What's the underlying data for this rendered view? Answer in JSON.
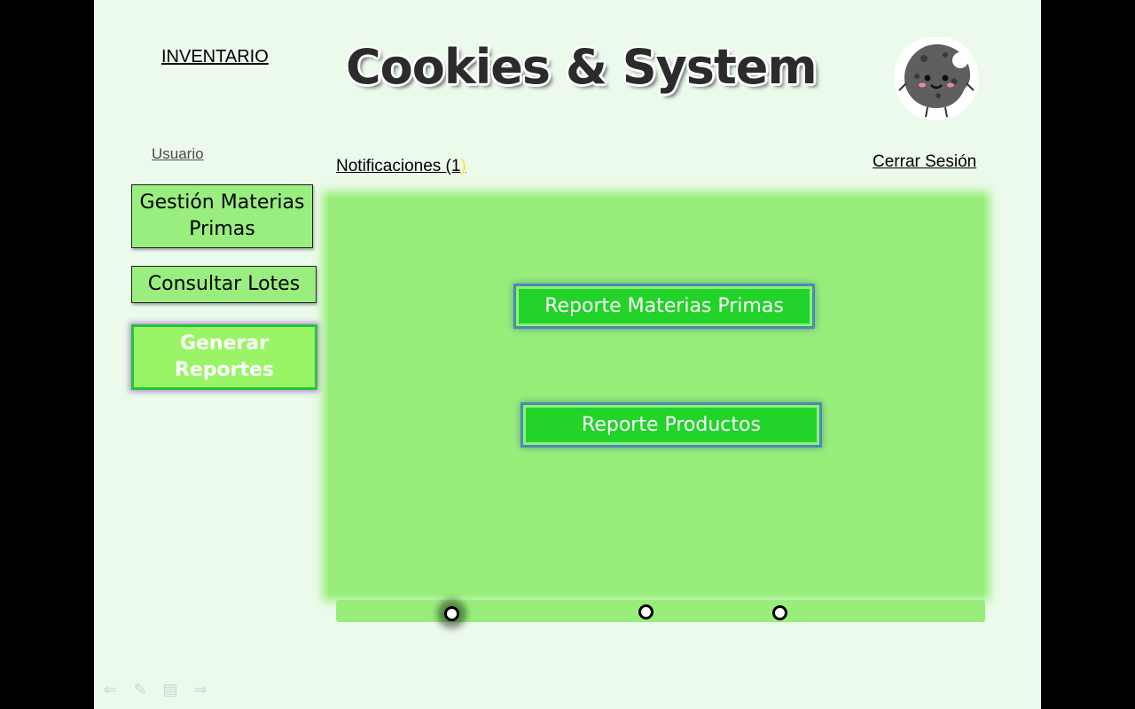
{
  "header": {
    "inventario_link": "INVENTARIO",
    "app_title": "Cookies & System",
    "logo_icon": "cookie-mascot-icon"
  },
  "user": {
    "usuario_label": "Usuario",
    "notifications": "Notificaciones (1",
    "notifications_close": ")",
    "logout": "Cerrar Sesión"
  },
  "sidebar": {
    "items": [
      {
        "label": "Gestión Materias Primas",
        "active": false
      },
      {
        "label": "Consultar Lotes",
        "active": false
      },
      {
        "label": "Generar Reportes",
        "active": true
      }
    ]
  },
  "main": {
    "reports": [
      {
        "label": "Reporte Materias Primas"
      },
      {
        "label": "Reporte Productos"
      }
    ]
  },
  "timeline": {
    "markers": 3,
    "selected": 1
  },
  "nav_icons": [
    "back-arrow-icon",
    "pen-icon",
    "menu-icon",
    "forward-arrow-icon"
  ],
  "colors": {
    "page_bg": "#ebfaeb",
    "panel_green": "#99ee7b",
    "button_green": "#22d32a",
    "active_border": "#1fc636"
  }
}
